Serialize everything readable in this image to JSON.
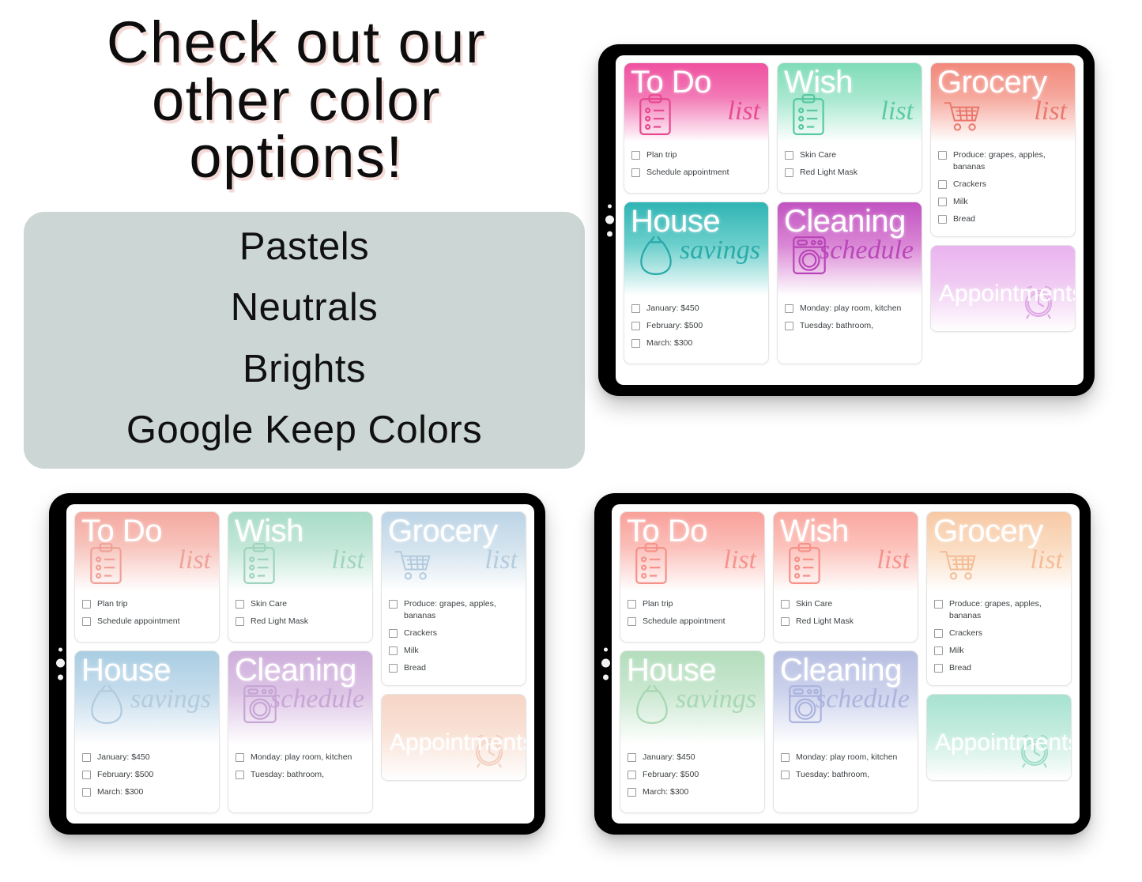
{
  "promo": {
    "heading_lines": [
      "Check out our",
      "other color",
      "options!"
    ],
    "options": [
      "Pastels",
      "Neutrals",
      "Brights",
      "Google Keep Colors"
    ],
    "options_card_color": "#ccd6d4",
    "heading_color": "#0d0d0d",
    "heading_shadow_color": "#f3d8d4"
  },
  "notes": {
    "todo": {
      "title": "To Do",
      "script": "list",
      "icon": "clipboard-icon",
      "items": [
        "Plan trip",
        "Schedule appointment"
      ]
    },
    "wish": {
      "title": "Wish",
      "script": "list",
      "icon": "clipboard-icon",
      "items": [
        "Skin Care",
        "Red Light Mask"
      ]
    },
    "grocery": {
      "title": "Grocery",
      "script": "list",
      "icon": "shopping-cart-icon",
      "items": [
        "Produce: grapes, apples, bananas",
        "Crackers",
        "Milk",
        "Bread"
      ]
    },
    "house": {
      "title": "House",
      "script": "savings",
      "icon": "money-bag-icon",
      "items": [
        "January: $450",
        "February: $500",
        "March: $300"
      ]
    },
    "clean": {
      "title": "Cleaning",
      "script": "schedule",
      "icon": "washing-machine-icon",
      "items": [
        "Monday: play room, kitchen",
        "Tuesday: bathroom,"
      ]
    },
    "appt": {
      "title": "Appointments",
      "script": "",
      "icon": "alarm-clock-icon",
      "items": []
    }
  },
  "tablets": [
    {
      "name": "brights-tablet",
      "palette": "Brights",
      "colors": {
        "todo": "#ef51a0",
        "wish": "#7fdcb9",
        "grocery": "#f1897c",
        "house": "#2fb4b4",
        "clean": "#c253c2",
        "appt": "#eab3ef"
      }
    },
    {
      "name": "pastels-tablet",
      "palette": "Pastels",
      "colors": {
        "todo": "#f4a9a0",
        "wish": "#a8dcc8",
        "grocery": "#bcd4e6",
        "house": "#a9cde2",
        "clean": "#ceaedb",
        "appt": "#f6d5c6"
      }
    },
    {
      "name": "neutrals-tablet",
      "palette": "Neutrals",
      "colors": {
        "todo": "#f9a09a",
        "wish": "#faa8a0",
        "grocery": "#f7c9a5",
        "house": "#b3ddbc",
        "clean": "#b7bfe2",
        "appt": "#a7e2d0"
      }
    }
  ]
}
